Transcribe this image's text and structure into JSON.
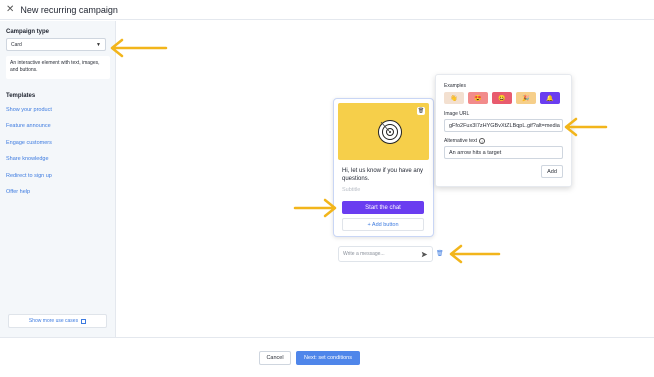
{
  "header": {
    "title": "New recurring campaign",
    "close_icon": "close-icon"
  },
  "sidebar": {
    "campaign_type_label": "Campaign type",
    "campaign_type_value": "Card",
    "campaign_type_description": "An interactive element with text, images, and buttons.",
    "templates_label": "Templates",
    "templates": [
      "Show your product",
      "Feature announce",
      "Engage customers",
      "Share knowledge",
      "Redirect to sign up",
      "Offer help"
    ],
    "more_use_cases": "Show more use cases"
  },
  "card": {
    "title": "Hi, let us know if you have any questions.",
    "subtitle_placeholder": "Subtitle",
    "cta_label": "Start the chat",
    "add_button_label": "+ Add button"
  },
  "message_input": {
    "placeholder": "Write a message..."
  },
  "image_popover": {
    "examples_label": "Examples",
    "examples": [
      "👋",
      "😍",
      "😀",
      "🎉",
      "🔔"
    ],
    "image_url_label": "Image URL",
    "image_url_value": "gFfo2Fux3I7zHYGBvXtZLBqpL.gif?alt=media",
    "alt_text_label": "Alternative text",
    "alt_text_value": "An arrow hits a target",
    "add_label": "Add"
  },
  "footer": {
    "cancel_label": "Cancel",
    "next_label": "Next: set conditions"
  },
  "colors": {
    "accent_purple": "#6a3df0",
    "link_blue": "#3d7be0",
    "primary_blue": "#4f86ea",
    "card_yellow": "#f6cf4a",
    "annotation_arrow": "#f2b51b"
  }
}
